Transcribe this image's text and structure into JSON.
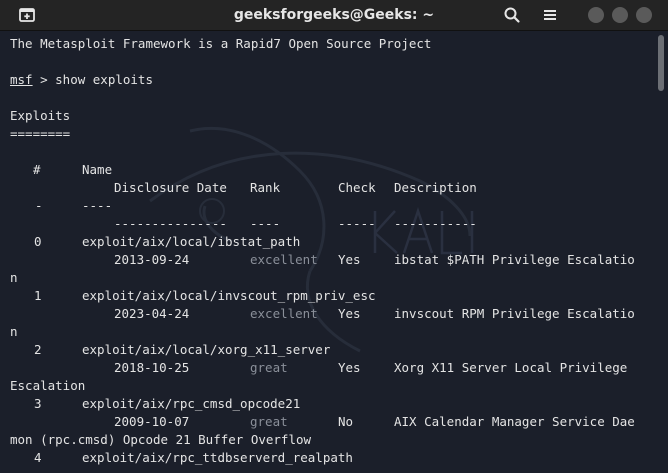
{
  "window": {
    "title": "geeksforgeeks@Geeks: ~"
  },
  "icons": {
    "new_tab": "new-tab-icon",
    "search": "search-icon",
    "menu": "hamburger-menu-icon",
    "minimize": "minimize-icon",
    "maximize": "maximize-icon",
    "close": "close-icon"
  },
  "terminal": {
    "banner": "The Metasploit Framework is a Rapid7 Open Source Project",
    "prompt_name": "msf",
    "prompt_rest": " > show exploits",
    "section_title": "Exploits",
    "section_rule": "========",
    "headers": {
      "num": "#",
      "name": "Name",
      "date": "Disclosure Date",
      "rank": "Rank",
      "check": "Check",
      "desc": "Description"
    },
    "rules": {
      "num": "-",
      "name": "----",
      "date": "---------------",
      "rank": "----",
      "check": "-----",
      "desc": "-----------"
    },
    "rows": [
      {
        "num": "0",
        "name": "exploit/aix/local/ibstat_path",
        "date": "2013-09-24",
        "rank": "excellent",
        "check": "Yes",
        "desc": "ibstat $PATH Privilege Escalatio",
        "wrap": "n"
      },
      {
        "num": "1",
        "name": "exploit/aix/local/invscout_rpm_priv_esc",
        "date": "2023-04-24",
        "rank": "excellent",
        "check": "Yes",
        "desc": "invscout RPM Privilege Escalatio",
        "wrap": "n"
      },
      {
        "num": "2",
        "name": "exploit/aix/local/xorg_x11_server",
        "date": "2018-10-25",
        "rank": "great",
        "check": "Yes",
        "desc": "Xorg X11 Server Local Privilege",
        "wrap": "Escalation"
      },
      {
        "num": "3",
        "name": "exploit/aix/rpc_cmsd_opcode21",
        "date": "2009-10-07",
        "rank": "great",
        "check": "No",
        "desc": "AIX Calendar Manager Service Dae",
        "wrap": "mon (rpc.cmsd) Opcode 21 Buffer Overflow"
      },
      {
        "num": "4",
        "name": "exploit/aix/rpc_ttdbserverd_realpath"
      }
    ]
  },
  "colors": {
    "background": "#1b1f2a",
    "titlebar": "#242424",
    "text": "#e4e4e4",
    "dim_text": "#8a8f99"
  }
}
